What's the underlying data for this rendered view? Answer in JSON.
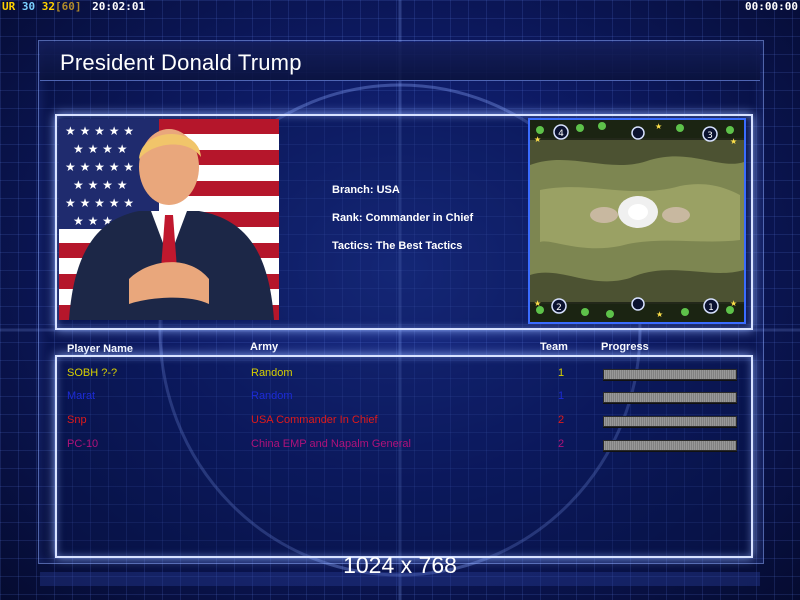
{
  "hud": {
    "left_prefix": "UR",
    "left_n1": "30",
    "left_n2": "32",
    "left_n3": "[60]",
    "left_clock": "20:02:01",
    "right_clock": "00:00:00"
  },
  "title": "President Donald Trump",
  "info": {
    "branch": "Branch: USA",
    "rank": "Rank: Commander in Chief",
    "tactics": "Tactics: The Best Tactics"
  },
  "map": {
    "start_positions": [
      "4",
      "3",
      "2",
      "1"
    ]
  },
  "columns": {
    "name": "Player Name",
    "army": "Army",
    "team": "Team",
    "progress": "Progress"
  },
  "players": [
    {
      "name": "SOBH ?-?",
      "army": "Random",
      "team": "1",
      "color": "#d8d000"
    },
    {
      "name": "Marat",
      "army": "Random",
      "team": "1",
      "color": "#1c2bd6"
    },
    {
      "name": "Snp",
      "army": "USA Commander In Chief",
      "team": "2",
      "color": "#e01a1a"
    },
    {
      "name": "PC-10",
      "army": "China EMP and Napalm General",
      "team": "2",
      "color": "#b0127a"
    }
  ],
  "resolution": "1024 x 768",
  "colors": {
    "panel_border": "#d8e2ff",
    "background": "#0d1a63",
    "map_border": "#3a6cff"
  }
}
